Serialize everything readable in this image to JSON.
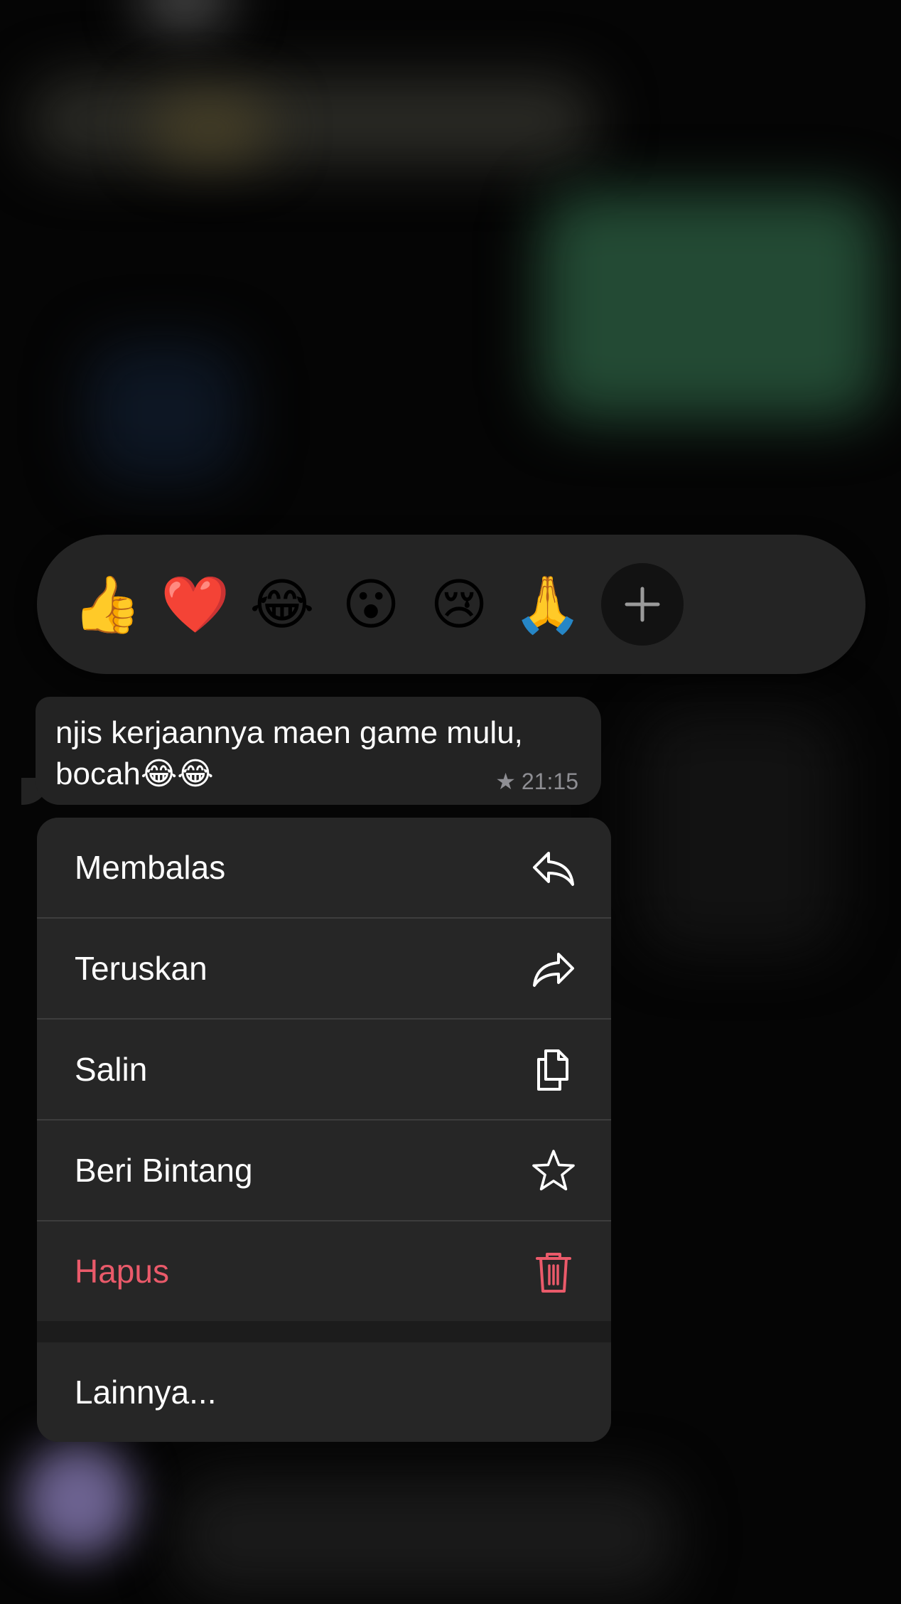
{
  "reactions": {
    "items": [
      "👍",
      "❤️",
      "😂",
      "😮",
      "😢",
      "🙏"
    ],
    "add_label": "+"
  },
  "message": {
    "text": "njis kerjaannya maen game mulu,\nbocah😂😂",
    "starred_icon": "star-icon",
    "time": "21:15"
  },
  "menu": {
    "reply": {
      "label": "Membalas",
      "icon": "reply-icon"
    },
    "forward": {
      "label": "Teruskan",
      "icon": "forward-icon"
    },
    "copy": {
      "label": "Salin",
      "icon": "copy-icon"
    },
    "star": {
      "label": "Beri Bintang",
      "icon": "star-outline-icon"
    },
    "delete": {
      "label": "Hapus",
      "icon": "trash-icon",
      "color": "#ea5a6a"
    },
    "more": {
      "label": "Lainnya..."
    }
  }
}
